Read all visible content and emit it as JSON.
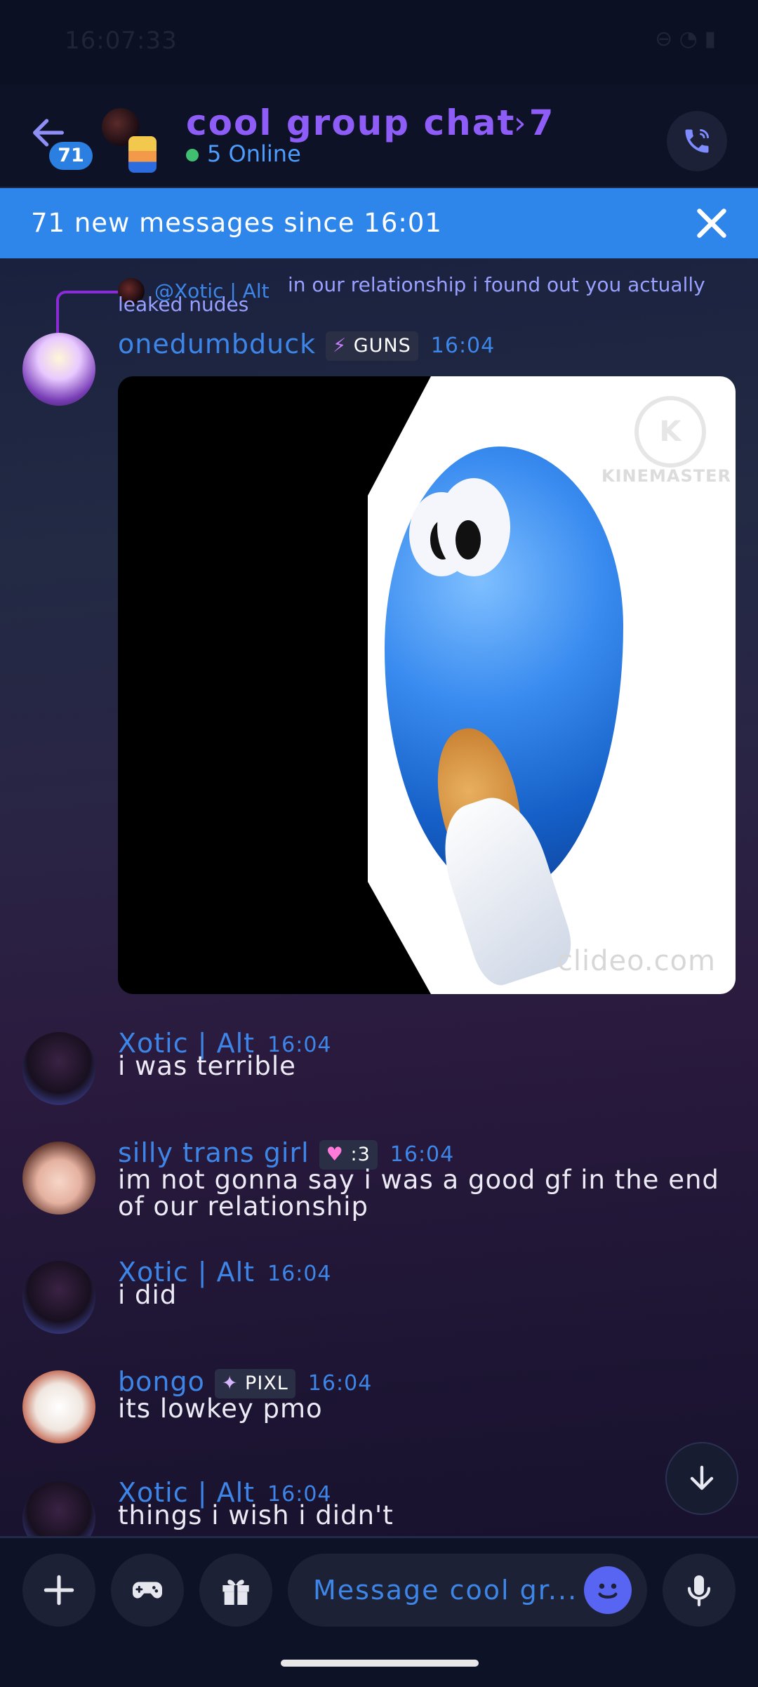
{
  "status": {
    "time": "16:07:33"
  },
  "header": {
    "unread_count": "71",
    "title": "cool group chat 7",
    "online": "5 Online"
  },
  "banner": {
    "text": "71 new messages since 16:01"
  },
  "reply": {
    "author": "@Xotic | Alt",
    "text": "in our relationship i found out you actually leaked nudes"
  },
  "messages": [
    {
      "author": "onedumbduck",
      "badge": "GUNS",
      "badge_icon": "lightning-icon",
      "time": "16:04",
      "text": "",
      "attachment": "video"
    },
    {
      "author": "Xotic | Alt",
      "badge": "",
      "time": "16:04",
      "text": "i was terrible"
    },
    {
      "author": "silly trans girl",
      "badge": ":3",
      "badge_icon": "heart-icon",
      "time": "16:04",
      "text": "im not gonna say i was a good gf in the end of our relationship"
    },
    {
      "author": "Xotic | Alt",
      "badge": "",
      "time": "16:04",
      "text": "i did"
    },
    {
      "author": "bongo",
      "badge": "PIXL",
      "badge_icon": "sparkle-icon",
      "time": "16:04",
      "text": "its lowkey pmo"
    },
    {
      "author": "Xotic | Alt",
      "badge": "",
      "time": "16:04",
      "text": "things i wish i didn't"
    }
  ],
  "video": {
    "watermark_top": "KINEMASTER",
    "watermark_bottom": "clideo.com",
    "logo_letter": "K"
  },
  "composer": {
    "placeholder": "Message cool gr..."
  },
  "colors": {
    "accent": "#2f86ea",
    "author": "#3d86e8",
    "title": "#8e5cf7"
  }
}
